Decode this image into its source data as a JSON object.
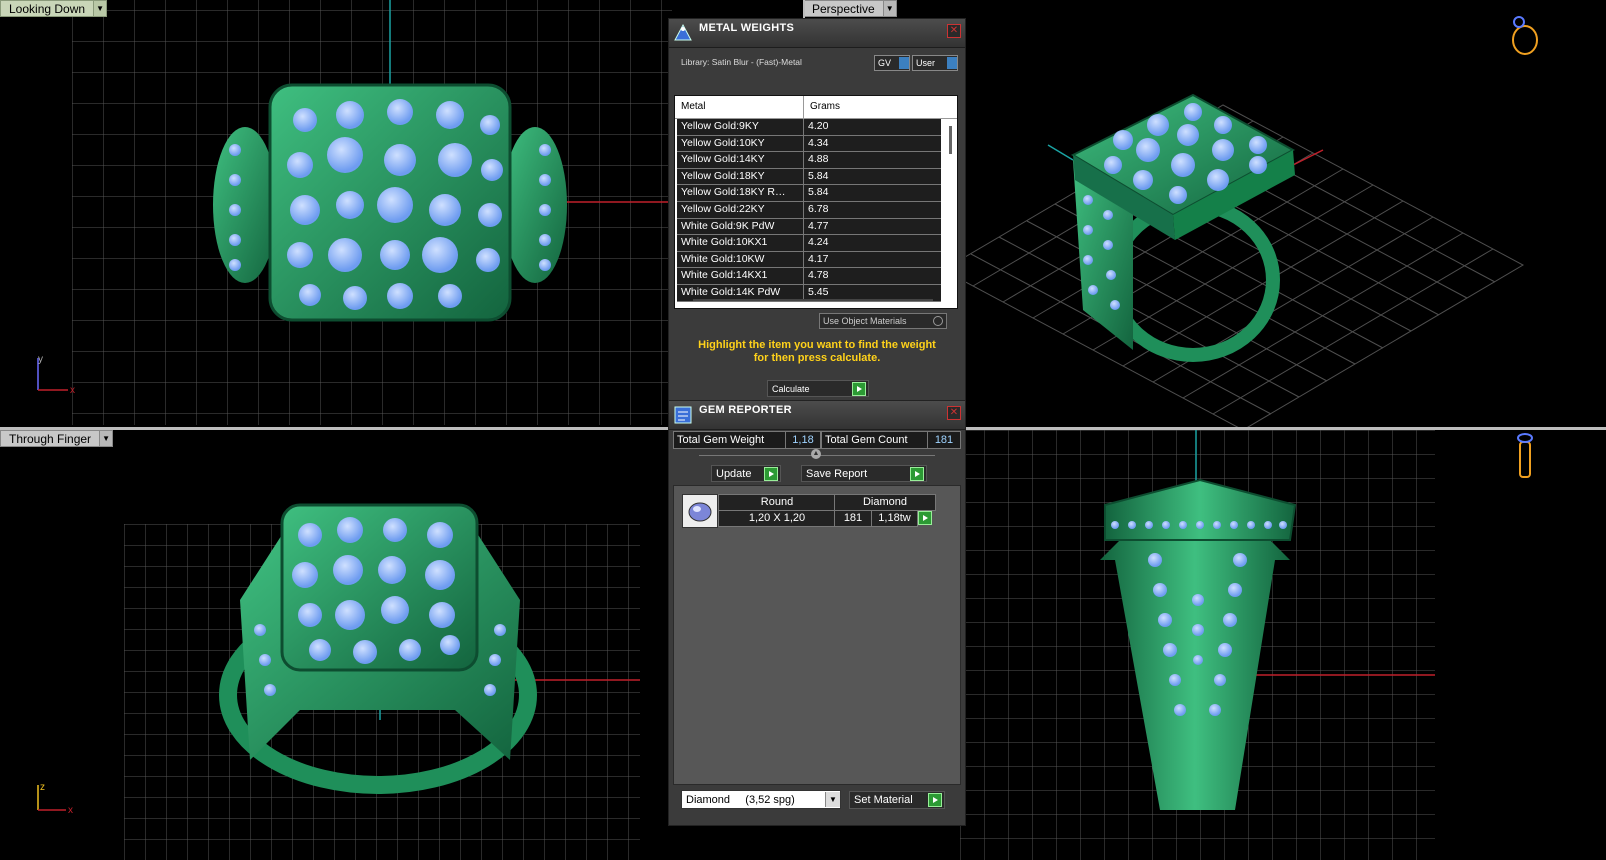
{
  "viewports": {
    "top_left": {
      "label": "Looking Down"
    },
    "top_right": {
      "label": "Perspective"
    },
    "bottom_left": {
      "label": "Through Finger"
    },
    "bottom_right": {
      "label": ""
    }
  },
  "axis": {
    "y": "y",
    "x": "x",
    "z": "z"
  },
  "metal_weights": {
    "title": "METAL WEIGHTS",
    "library": "Library: Satin Blur - (Fast)-Metal",
    "gv_label": "GV",
    "user_label": "User",
    "columns": [
      "Metal",
      "Grams"
    ],
    "rows": [
      {
        "metal": "Yellow Gold:9KY",
        "grams": "4.20"
      },
      {
        "metal": "Yellow Gold:10KY",
        "grams": "4.34"
      },
      {
        "metal": "Yellow Gold:14KY",
        "grams": "4.88"
      },
      {
        "metal": "Yellow Gold:18KY",
        "grams": "5.84"
      },
      {
        "metal": "Yellow Gold:18KY R…",
        "grams": "5.84"
      },
      {
        "metal": "Yellow Gold:22KY",
        "grams": "6.78"
      },
      {
        "metal": "White Gold:9K PdW",
        "grams": "4.77"
      },
      {
        "metal": "White Gold:10KX1",
        "grams": "4.24"
      },
      {
        "metal": "White Gold:10KW",
        "grams": "4.17"
      },
      {
        "metal": "White Gold:14KX1",
        "grams": "4.78"
      },
      {
        "metal": "White Gold:14K PdW",
        "grams": "5.45"
      }
    ],
    "use_object_materials": "Use Object Materials",
    "hint_line1": "Highlight the item you want to find the weight",
    "hint_line2": "for then press calculate.",
    "calculate_label": "Calculate"
  },
  "gem_reporter": {
    "title": "GEM REPORTER",
    "total_weight_label": "Total Gem Weight",
    "total_weight_value": "1,18",
    "total_count_label": "Total Gem Count",
    "total_count_value": "181",
    "update_label": "Update",
    "save_report_label": "Save Report",
    "gem": {
      "shape": "Round",
      "size": "1,20 X 1,20",
      "material": "Diamond",
      "count": "181",
      "weight": "1,18tw"
    },
    "material_select": "Diamond     (3,52 spg)",
    "set_material_label": "Set Material"
  },
  "colors": {
    "ring": "#1f8f5a",
    "stone": "#8fb8ff",
    "hint": "#ffd21a",
    "grid": "#5a5a5a"
  }
}
